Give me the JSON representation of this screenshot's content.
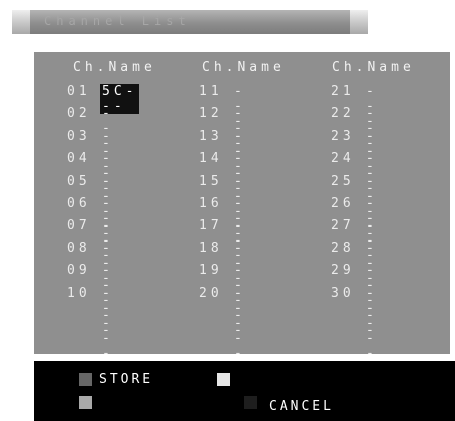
{
  "window": {
    "title": "Channel List"
  },
  "headers": [
    "Ch.Name",
    "Ch.Name",
    "Ch.Name"
  ],
  "channels": [
    [
      {
        "num": "01",
        "name": "5C---"
      },
      {
        "num": "02",
        "name": "-----"
      },
      {
        "num": "03",
        "name": "-----"
      },
      {
        "num": "04",
        "name": "-----"
      },
      {
        "num": "05",
        "name": "-----"
      },
      {
        "num": "06",
        "name": "-----"
      },
      {
        "num": "07",
        "name": "-----"
      },
      {
        "num": "08",
        "name": "-----"
      },
      {
        "num": "09",
        "name": "-----"
      },
      {
        "num": "10",
        "name": "-----"
      }
    ],
    [
      {
        "num": "11",
        "name": "-----"
      },
      {
        "num": "12",
        "name": "-----"
      },
      {
        "num": "13",
        "name": "-----"
      },
      {
        "num": "14",
        "name": "-----"
      },
      {
        "num": "15",
        "name": "-----"
      },
      {
        "num": "16",
        "name": "-----"
      },
      {
        "num": "17",
        "name": "-----"
      },
      {
        "num": "18",
        "name": "-----"
      },
      {
        "num": "19",
        "name": "-----"
      },
      {
        "num": "20",
        "name": "-----"
      }
    ],
    [
      {
        "num": "21",
        "name": "-----"
      },
      {
        "num": "22",
        "name": "-----"
      },
      {
        "num": "23",
        "name": "-----"
      },
      {
        "num": "24",
        "name": "-----"
      },
      {
        "num": "25",
        "name": "-----"
      },
      {
        "num": "26",
        "name": "-----"
      },
      {
        "num": "27",
        "name": "-----"
      },
      {
        "num": "28",
        "name": "-----"
      },
      {
        "num": "29",
        "name": "-----"
      },
      {
        "num": "30",
        "name": "-----"
      }
    ]
  ],
  "selected_channel": "01",
  "footer": {
    "store_label": "STORE",
    "cancel_label": "CANCEL"
  },
  "colors": {
    "panel": "#8f8f8f",
    "footer": "#000000",
    "text": "#ebebeb",
    "selection": "#111111"
  }
}
